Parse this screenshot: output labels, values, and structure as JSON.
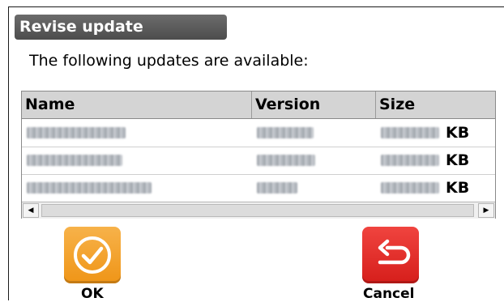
{
  "dialog": {
    "title": "Revise update",
    "subtitle": "The following updates are available:"
  },
  "table": {
    "headers": {
      "name": "Name",
      "version": "Version",
      "size": "Size"
    },
    "rows": [
      {
        "size_unit": "KB"
      },
      {
        "size_unit": "KB"
      },
      {
        "size_unit": "KB"
      }
    ]
  },
  "actions": {
    "ok_label": "OK",
    "cancel_label": "Cancel",
    "ok_icon": "checkmark-icon",
    "cancel_icon": "return-arrow-icon",
    "ok_color": "#F2A12B",
    "cancel_color": "#E1302C"
  },
  "colors": {
    "title_bar": "#5A5A5A",
    "header_bg": "#D4D4D4"
  }
}
